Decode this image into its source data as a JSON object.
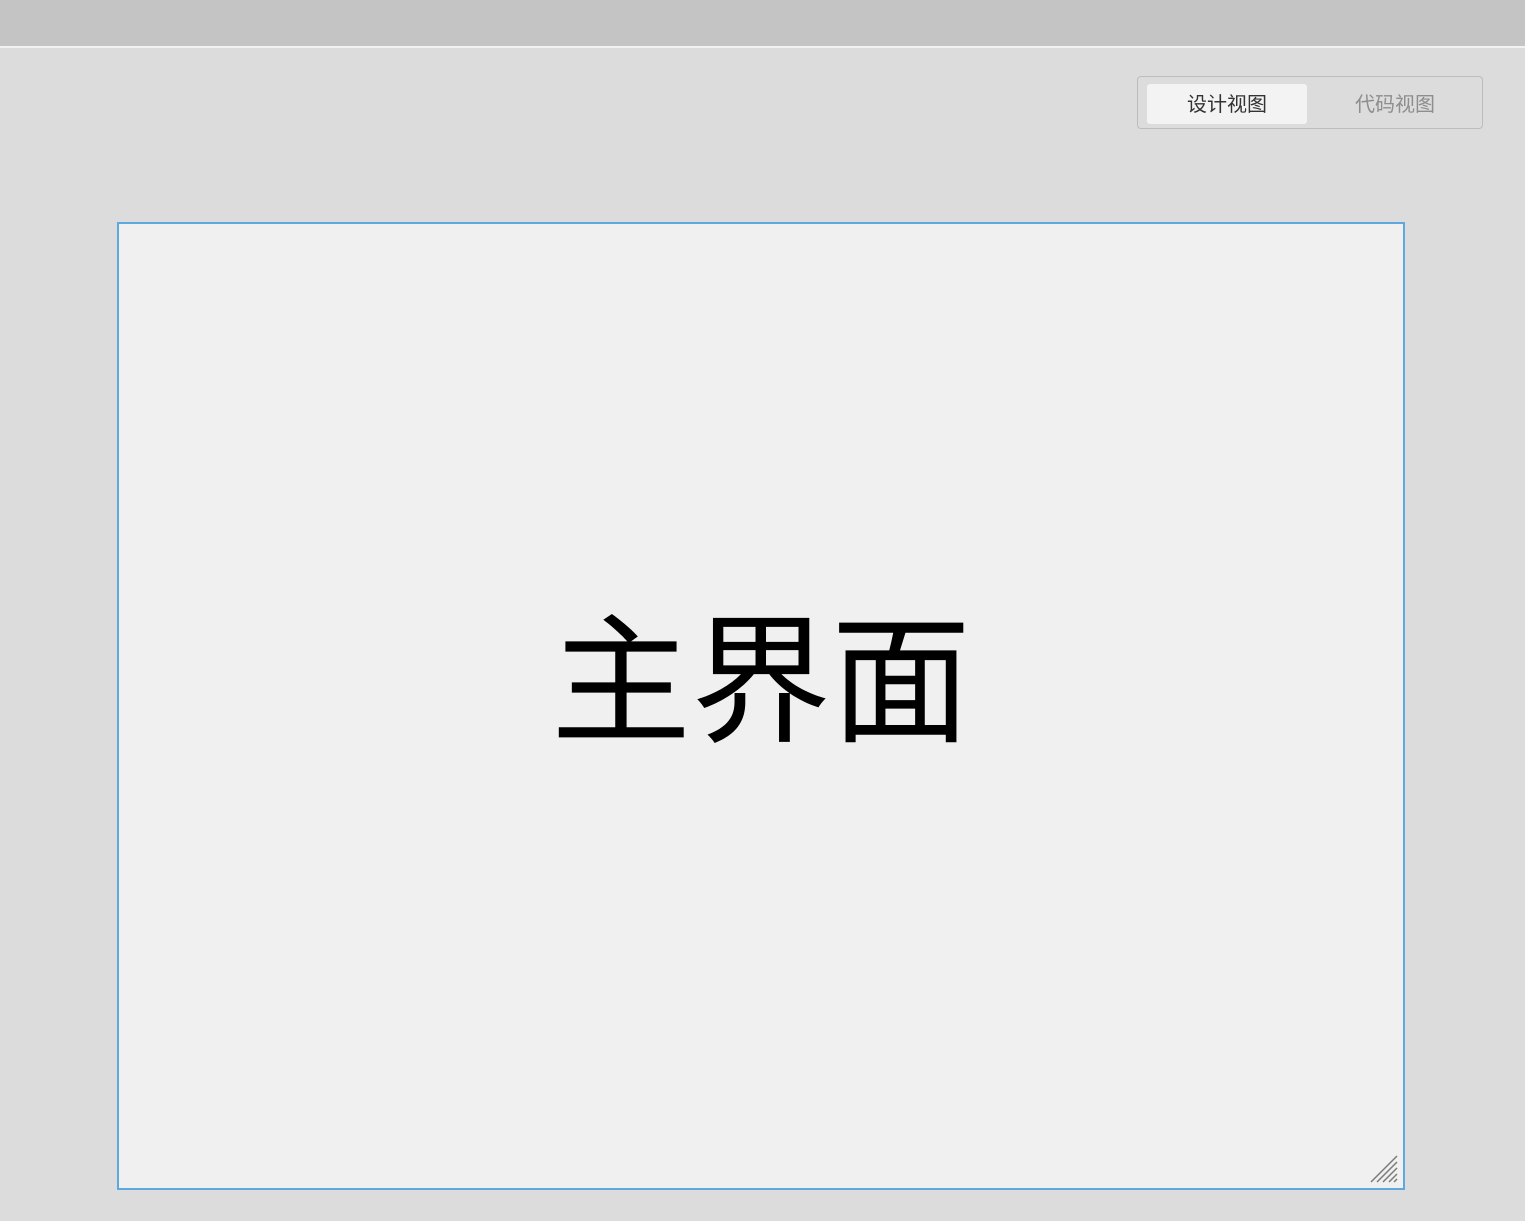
{
  "toolbar": {
    "design_view_label": "设计视图",
    "code_view_label": "代码视图",
    "active_view": "design"
  },
  "canvas": {
    "title": "主界面",
    "border_color": "#5ea8e0",
    "background_color": "#f0f0f0"
  },
  "icons": {
    "resize_handle": "resize-grip-icon"
  }
}
